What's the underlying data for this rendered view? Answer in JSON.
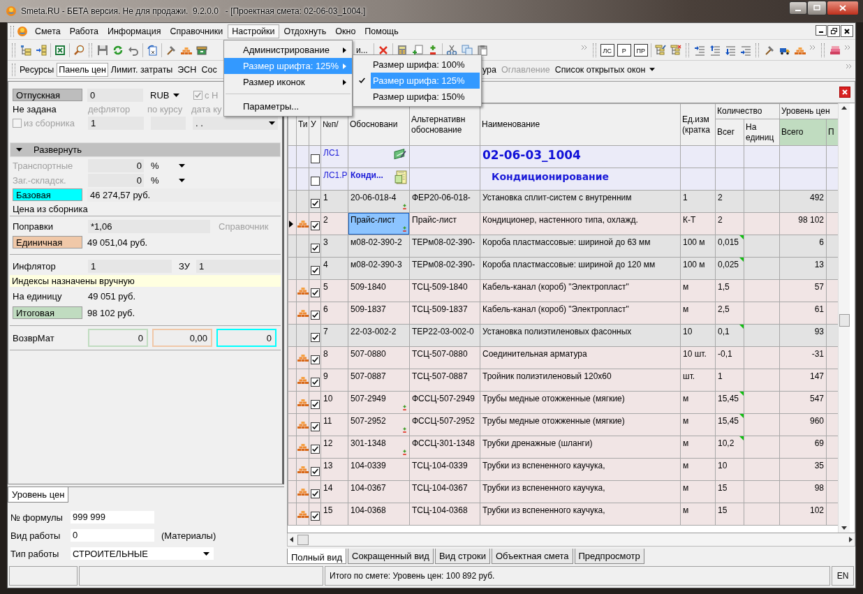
{
  "window": {
    "title": "Smeta.RU - БЕТА версия. Не для продажи.  9.2.0.0   - [Проектная смета: 02-06-03_1004.]"
  },
  "menu": {
    "items": [
      {
        "label": "Смета",
        "selected": false
      },
      {
        "label": "Работа",
        "selected": false
      },
      {
        "label": "Информация",
        "selected": false
      },
      {
        "label": "Справочники",
        "selected": false
      },
      {
        "label": "Настройки",
        "selected": true
      },
      {
        "label": "Отдохнуть",
        "selected": false
      },
      {
        "label": "Окно",
        "selected": false
      },
      {
        "label": "Помощь",
        "selected": false
      }
    ]
  },
  "dropdown": {
    "items": [
      {
        "kind": "submenu",
        "label": "Администрирование",
        "selected": false
      },
      {
        "kind": "submenu",
        "label": "Размер шрифта: 125%",
        "selected": true
      },
      {
        "kind": "submenu",
        "label": "Размер иконок",
        "selected": false
      },
      {
        "kind": "separator"
      },
      {
        "kind": "item",
        "label": "Параметры...",
        "selected": false
      }
    ],
    "submenu": [
      {
        "label": "Размер шрифа: 100%",
        "checked": false,
        "selected": false
      },
      {
        "label": "Размер шрифа: 125%",
        "checked": true,
        "selected": true
      },
      {
        "label": "Размер шрифа: 150%",
        "checked": false,
        "selected": false
      }
    ]
  },
  "toolbar": {
    "fragment": "и...",
    "doc_buttons": [
      "ЛС",
      "Р",
      "ПР"
    ]
  },
  "panel_tabs": [
    {
      "label": "Ресурсы",
      "selected": false,
      "disabled": false
    },
    {
      "label": "Панель цен",
      "selected": true,
      "disabled": false
    },
    {
      "label": "Лимит. затраты",
      "selected": false,
      "disabled": false
    },
    {
      "label": "ЭСН",
      "selected": false,
      "disabled": false
    },
    {
      "label": "Сос",
      "selected": false,
      "disabled": false
    }
  ],
  "panel_tabs_right": [
    {
      "label": "ура",
      "selected": false,
      "disabled": false
    },
    {
      "label": "Оглавление",
      "selected": false,
      "disabled": true
    },
    {
      "label": "Список открытых окон",
      "selected": false,
      "disabled": false,
      "kind": "dropdown"
    }
  ],
  "price_panel": {
    "release": {
      "label": "Отпускная",
      "value": "0",
      "currency": "RUB",
      "vat": {
        "label": "с Н",
        "checked": true
      }
    },
    "captions": [
      "Не задана",
      "дефлятор",
      "по курсу",
      "дата ку"
    ],
    "source": {
      "label": "из сборника",
      "checked": false,
      "value": "1",
      "date": ". ."
    },
    "expand": {
      "label": "Развернуть"
    },
    "overheads": [
      {
        "label": "Транспортные",
        "value": "0",
        "unit": "%"
      },
      {
        "label": "Заг.-складск.",
        "value": "0",
        "unit": "%"
      }
    ],
    "base": {
      "label": "Базовая",
      "value": "46 274,57 руб.",
      "note": "Цена из сборника"
    },
    "corrections": {
      "label": "Поправки",
      "value": "*1,06",
      "link": "Справочник"
    },
    "unit_price": {
      "label": "Единичная",
      "value": "49 051,04 руб."
    },
    "inflator": {
      "label": "Инфлятор",
      "value": "1",
      "zu_label": "ЗУ",
      "zu_value": "1"
    },
    "notice": "Индексы назначены вручную",
    "per_unit": {
      "label": "На единицу",
      "value": "49 051 руб."
    },
    "total": {
      "label": "Итоговая",
      "value": "98 102 руб."
    },
    "return": {
      "label": "ВозврМат",
      "values": [
        {
          "value": "0",
          "color": "#c0dcc0"
        },
        {
          "value": "0,00",
          "color": "#f0c8a8"
        },
        {
          "value": "0",
          "color": "#00ffff"
        }
      ]
    }
  },
  "level_tab": {
    "label": "Уровень цен",
    "selected": true
  },
  "level_form": [
    {
      "kind": "field",
      "label": "№ формулы",
      "value": "999 999"
    },
    {
      "kind": "field",
      "label": "Вид работы",
      "value": "0",
      "note": "(Материалы)"
    },
    {
      "kind": "dropdown",
      "label": "Тип работы",
      "value": "СТРОИТЕЛЬНЫЕ"
    }
  ],
  "grid": {
    "columns": [
      {
        "label": "Ти"
      },
      {
        "label": "У"
      },
      {
        "label": "№п/"
      },
      {
        "label": "Обосновани"
      },
      {
        "label": "Альтернативн\nобоснование"
      },
      {
        "label": "Наименование"
      },
      {
        "label": "Ед.изм\n(кратка"
      },
      {
        "label": "Количество",
        "children": [
          {
            "label": "Всег"
          },
          {
            "label": "На\nединиц"
          }
        ]
      },
      {
        "label": "Уровень цен",
        "children": [
          {
            "label": "Всего"
          },
          {
            "label": "П"
          }
        ]
      }
    ],
    "rows": [
      {
        "kind": "estimate",
        "selected": false,
        "checked": false,
        "num": "ЛС1",
        "name": "02-06-03_1004"
      },
      {
        "kind": "section",
        "selected": false,
        "checked": false,
        "num": "ЛС1.Р",
        "code": "Конди...",
        "name": "Кондиционирование"
      },
      {
        "kind": "work",
        "selected": false,
        "checked": true,
        "num": "1",
        "code": "20-06-018-4",
        "adjusted": true,
        "alt": "ФЕР20-06-018-",
        "name": "Установка сплит-систем с внутренним",
        "unit": "1",
        "qty": "2",
        "qty_flag": false,
        "price": "492"
      },
      {
        "kind": "material",
        "selected": true,
        "checked": true,
        "num": "2",
        "code": "Прайс-лист",
        "adjusted": true,
        "alt": "Прайс-лист",
        "name": "Кондиционер, настенного типа, охлажд.",
        "unit": "К-Т",
        "qty": "2",
        "qty_flag": false,
        "price": "98 102"
      },
      {
        "kind": "work",
        "selected": false,
        "checked": true,
        "num": "3",
        "code": "м08-02-390-2",
        "adjusted": false,
        "alt": "ТЕРм08-02-390-",
        "name": "Короба пластмассовые: шириной до 63 мм",
        "unit": "100 м",
        "qty": "0,015",
        "qty_flag": true,
        "price": "6"
      },
      {
        "kind": "work",
        "selected": false,
        "checked": true,
        "num": "4",
        "code": "м08-02-390-3",
        "adjusted": false,
        "alt": "ТЕРм08-02-390-",
        "name": "Короба пластмассовые: шириной до 120 мм",
        "unit": "100 м",
        "qty": "0,025",
        "qty_flag": true,
        "price": "13"
      },
      {
        "kind": "material",
        "selected": false,
        "checked": true,
        "num": "5",
        "code": "509-1840",
        "adjusted": false,
        "alt": "ТСЦ-509-1840",
        "name": "Кабель-канал (короб) \"Электропласт\"",
        "unit": "м",
        "qty": "1,5",
        "qty_flag": false,
        "price": "57"
      },
      {
        "kind": "material",
        "selected": false,
        "checked": true,
        "num": "6",
        "code": "509-1837",
        "adjusted": false,
        "alt": "ТСЦ-509-1837",
        "name": "Кабель-канал (короб) \"Электропласт\"",
        "unit": "м",
        "qty": "2,5",
        "qty_flag": false,
        "price": "61"
      },
      {
        "kind": "work",
        "selected": false,
        "checked": true,
        "num": "7",
        "code": "22-03-002-2",
        "adjusted": false,
        "alt": "ТЕР22-03-002-0",
        "name": "Установка полиэтиленовых фасонных",
        "unit": "10",
        "qty": "0,1",
        "qty_flag": true,
        "price": "93"
      },
      {
        "kind": "material",
        "selected": false,
        "checked": true,
        "num": "8",
        "code": "507-0880",
        "adjusted": false,
        "alt": "ТСЦ-507-0880",
        "name": "Соединительная арматура",
        "unit": "10 шт.",
        "qty": "-0,1",
        "qty_flag": false,
        "price": "-31"
      },
      {
        "kind": "material",
        "selected": false,
        "checked": true,
        "num": "9",
        "code": "507-0887",
        "adjusted": false,
        "alt": "ТСЦ-507-0887",
        "name": "Тройник полиэтиленовый 120x60",
        "unit": "шт.",
        "qty": "1",
        "qty_flag": false,
        "price": "147"
      },
      {
        "kind": "material",
        "selected": false,
        "checked": true,
        "num": "10",
        "code": "507-2949",
        "adjusted": true,
        "alt": "ФССЦ-507-2949",
        "name": "Трубы медные отожженные (мягкие)",
        "unit": "м",
        "qty": "15,45",
        "qty_flag": true,
        "price": "547"
      },
      {
        "kind": "material",
        "selected": false,
        "checked": true,
        "num": "11",
        "code": "507-2952",
        "adjusted": true,
        "alt": "ФССЦ-507-2952",
        "name": "Трубы медные отожженные (мягкие)",
        "unit": "м",
        "qty": "15,45",
        "qty_flag": true,
        "price": "960"
      },
      {
        "kind": "material",
        "selected": false,
        "checked": true,
        "num": "12",
        "code": "301-1348",
        "adjusted": true,
        "alt": "ФССЦ-301-1348",
        "name": "Трубки дренажные (шланги)",
        "unit": "м",
        "qty": "10,2",
        "qty_flag": true,
        "price": "69"
      },
      {
        "kind": "material",
        "selected": false,
        "checked": true,
        "num": "13",
        "code": "104-0339",
        "adjusted": false,
        "alt": "ТСЦ-104-0339",
        "name": "Трубки из вспененного каучука,",
        "unit": "м",
        "qty": "10",
        "qty_flag": false,
        "price": "35"
      },
      {
        "kind": "material",
        "selected": false,
        "checked": true,
        "num": "14",
        "code": "104-0367",
        "adjusted": false,
        "alt": "ТСЦ-104-0367",
        "name": "Трубки из вспененного каучука,",
        "unit": "м",
        "qty": "15",
        "qty_flag": false,
        "price": "98"
      },
      {
        "kind": "material",
        "selected": false,
        "checked": true,
        "num": "15",
        "code": "104-0368",
        "adjusted": false,
        "alt": "ТСЦ-104-0368",
        "name": "Трубки из вспененного каучука,",
        "unit": "м",
        "qty": "15",
        "qty_flag": false,
        "price": "102"
      }
    ]
  },
  "doc_tabs": [
    {
      "label": "Полный вид",
      "selected": true
    },
    {
      "label": "Сокращенный вид",
      "selected": false
    },
    {
      "label": "Вид строки",
      "selected": false
    },
    {
      "label": "Объектная смета",
      "selected": false
    },
    {
      "label": "Предпросмотр",
      "selected": false
    }
  ],
  "status_bar": {
    "text": "Итого по смете: Уровень цен: 100 892 руб.",
    "lang": "EN"
  }
}
